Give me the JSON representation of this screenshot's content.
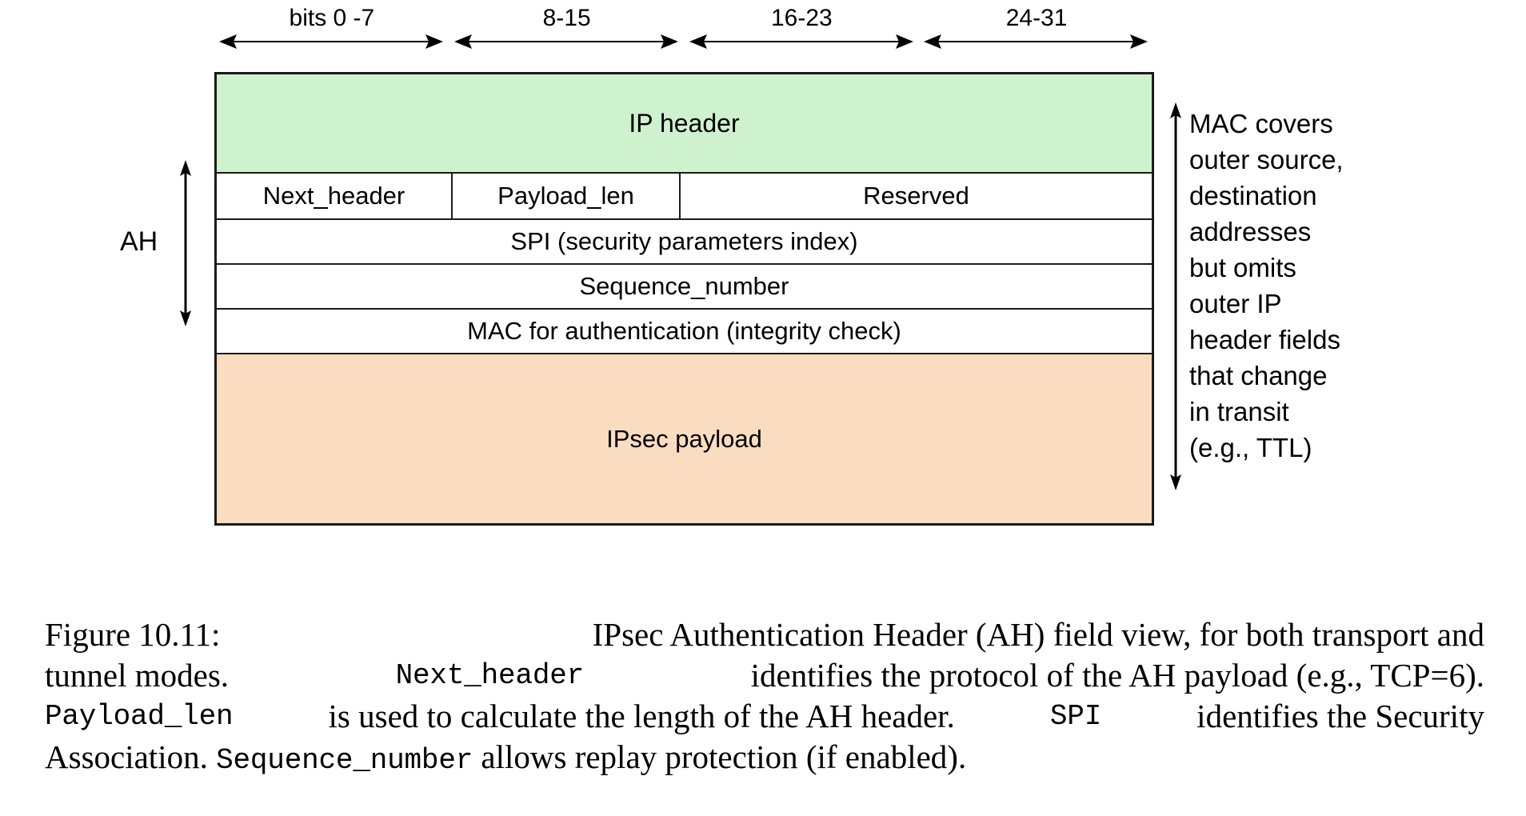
{
  "figure": {
    "bit_ruler": [
      {
        "label": "bits 0 -7"
      },
      {
        "label": "8-15"
      },
      {
        "label": "16-23"
      },
      {
        "label": "24-31"
      }
    ],
    "rows": {
      "ip_header": "IP header",
      "next_header": "Next_header",
      "payload_len": "Payload_len",
      "reserved": "Reserved",
      "spi": "SPI (security parameters index)",
      "sequence_number": "Sequence_number",
      "mac": "MAC for authentication (integrity check)",
      "ipsec_payload": "IPsec payload"
    },
    "ah_label": "AH",
    "mac_note_lines": [
      "MAC covers",
      "outer source,",
      "destination",
      "addresses",
      "but omits",
      "outer IP",
      "header fields",
      "that change",
      "in transit",
      "(e.g., TTL)"
    ],
    "colors": {
      "ip_header_fill": "#cdf2cd",
      "payload_fill": "#fadcc0",
      "stroke": "#1a1a1a",
      "text": "#000000",
      "background": "#ffffff"
    }
  },
  "caption": {
    "figure_number": "Figure 10.11:",
    "line1_a": "IPsec Authentication Header (AH) field view, for both transport and",
    "line2_a": "tunnel modes.",
    "line2_mono": "Next_header",
    "line2_b": "identifies the protocol of the AH payload (e.g., TCP=6).",
    "line3_mono": "Payload_len",
    "line3_a": "is used to calculate the length of the AH header.",
    "line3_mono2": "SPI",
    "line3_b": "identifies the Security",
    "line4_a": "Association.",
    "line4_mono": "Sequence_number",
    "line4_b": "allows replay protection (if enabled)."
  }
}
